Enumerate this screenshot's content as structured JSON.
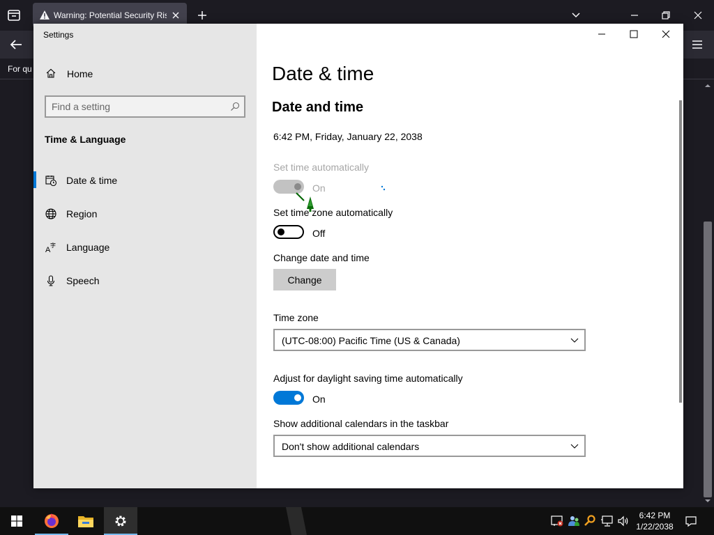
{
  "browser": {
    "tab_title": "Warning: Potential Security Risk",
    "notice_text": "For qu"
  },
  "settings": {
    "app_title": "Settings",
    "home_label": "Home",
    "search_placeholder": "Find a setting",
    "group_title": "Time & Language",
    "nav_items": [
      {
        "label": "Date & time",
        "icon": "calendar-clock-icon",
        "selected": true
      },
      {
        "label": "Region",
        "icon": "globe-icon",
        "selected": false
      },
      {
        "label": "Language",
        "icon": "language-icon",
        "selected": false
      },
      {
        "label": "Speech",
        "icon": "microphone-icon",
        "selected": false
      }
    ],
    "page_title": "Date & time",
    "section_title": "Date and time",
    "current_time": "6:42 PM, Friday, January 22, 2038",
    "set_time_auto": {
      "label": "Set time automatically",
      "state": "On",
      "disabled": true
    },
    "set_tz_auto": {
      "label": "Set time zone automatically",
      "state": "Off"
    },
    "change_label": "Change date and time",
    "change_button": "Change",
    "timezone_label": "Time zone",
    "timezone_value": "(UTC-08:00) Pacific Time (US & Canada)",
    "dst": {
      "label": "Adjust for daylight saving time automatically",
      "state": "On"
    },
    "calendars_label": "Show additional calendars in the taskbar",
    "calendars_value": "Don't show additional calendars"
  },
  "taskbar": {
    "time": "6:42 PM",
    "date": "1/22/2038",
    "accent": "#76b9ed"
  },
  "colors": {
    "accent": "#0078d7",
    "sidebar_bg": "#e6e6e6",
    "browser_bg": "#1c1b22"
  }
}
